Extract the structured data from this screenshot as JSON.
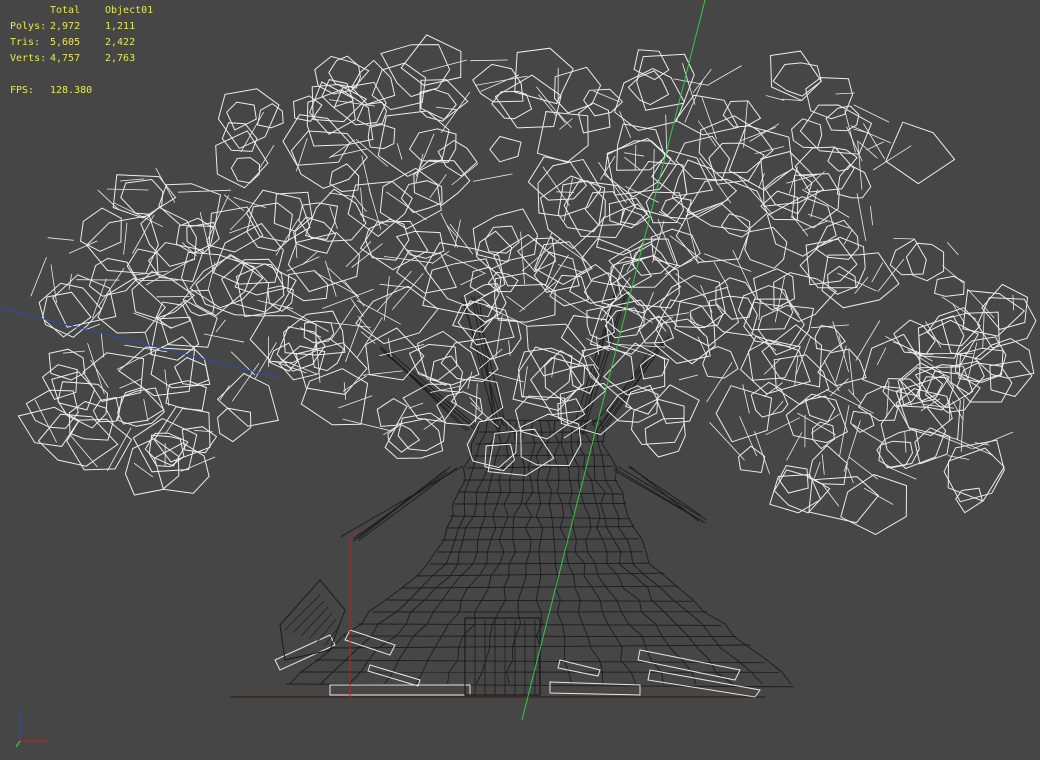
{
  "stats": {
    "header_total": "Total",
    "header_object": "Object01",
    "rows": [
      {
        "label": "Polys:",
        "total": "2,972",
        "object": "1,211"
      },
      {
        "label": "Tris:",
        "total": "5,605",
        "object": "2,422"
      },
      {
        "label": "Verts:",
        "total": "4,757",
        "object": "2,763"
      }
    ],
    "fps_label": "FPS:",
    "fps_value": "128.380"
  },
  "colors": {
    "background": "#464646",
    "stats_text": "#e8e84a",
    "canopy_wire": "#ececec",
    "trunk_wire": "#1c1c1c",
    "axis_y": "#2ecc40",
    "axis_x": "#d02020",
    "axis_z": "#2a4da8"
  },
  "icons": {
    "gizmo": "axis-tripod-icon"
  }
}
